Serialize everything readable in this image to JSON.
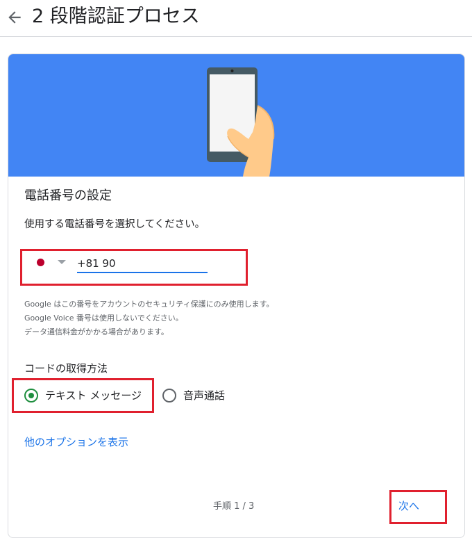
{
  "header": {
    "title": "2 段階認証プロセス",
    "back_icon": "arrow-left-icon"
  },
  "colors": {
    "hero_bg": "#4285f4",
    "accent": "#1a73e8",
    "radio_selected": "#1e8e3e",
    "highlight": "#e0202e"
  },
  "card": {
    "illustration": "hand-holding-phone",
    "title": "電話番号の設定",
    "instruction": "使用する電話番号を選択してください。",
    "phone": {
      "country": "JP",
      "value": "+81 90"
    },
    "notes": [
      "Google はこの番号をアカウントのセキュリティ保護にのみ使用します。",
      "Google Voice 番号は使用しないでください。",
      "データ通信料金がかかる場合があります。"
    ],
    "method_label": "コードの取得方法",
    "methods": [
      {
        "label": "テキスト メッセージ",
        "selected": true
      },
      {
        "label": "音声通話",
        "selected": false
      }
    ],
    "more_options": "他のオプションを表示",
    "step": "手順 1 / 3",
    "next": "次へ"
  }
}
